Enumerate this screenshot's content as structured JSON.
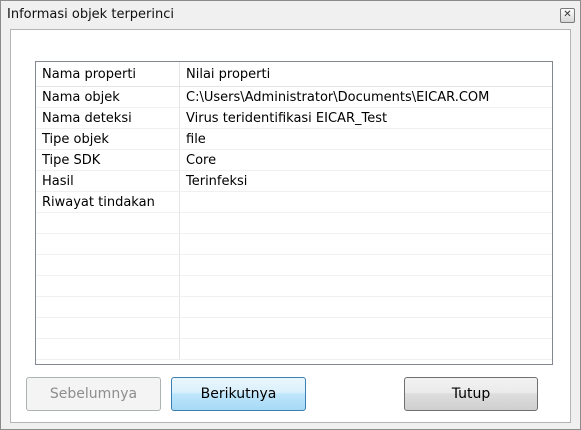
{
  "window": {
    "title": "Informasi objek terperinci",
    "close_glyph": "✕"
  },
  "table": {
    "headers": [
      "Nama properti",
      "Nilai properti"
    ],
    "rows": [
      [
        "Nama objek",
        "C:\\Users\\Administrator\\Documents\\EICAR.COM"
      ],
      [
        "Nama deteksi",
        "Virus teridentifikasi EICAR_Test"
      ],
      [
        "Tipe objek",
        "file"
      ],
      [
        "Tipe SDK",
        "Core"
      ],
      [
        "Hasil",
        "Terinfeksi"
      ],
      [
        "Riwayat tindakan",
        ""
      ],
      [
        "",
        ""
      ],
      [
        "",
        ""
      ],
      [
        "",
        ""
      ],
      [
        "",
        ""
      ],
      [
        "",
        ""
      ],
      [
        "",
        ""
      ],
      [
        "",
        ""
      ]
    ]
  },
  "buttons": {
    "previous": "Sebelumnya",
    "next": "Berikutnya",
    "close": "Tutup"
  }
}
